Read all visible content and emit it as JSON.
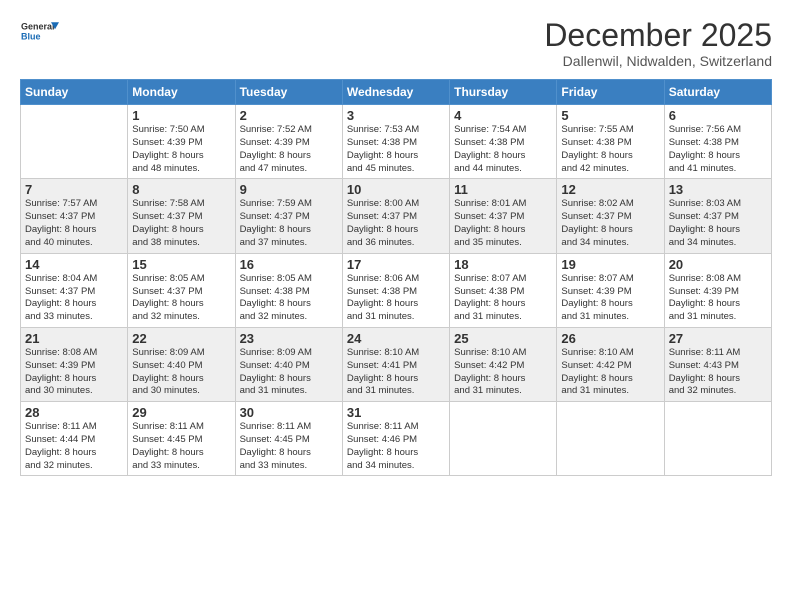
{
  "header": {
    "logo_general": "General",
    "logo_blue": "Blue",
    "month_title": "December 2025",
    "subtitle": "Dallenwil, Nidwalden, Switzerland"
  },
  "days_of_week": [
    "Sunday",
    "Monday",
    "Tuesday",
    "Wednesday",
    "Thursday",
    "Friday",
    "Saturday"
  ],
  "weeks": [
    [
      {
        "num": "",
        "info": ""
      },
      {
        "num": "1",
        "info": "Sunrise: 7:50 AM\nSunset: 4:39 PM\nDaylight: 8 hours\nand 48 minutes."
      },
      {
        "num": "2",
        "info": "Sunrise: 7:52 AM\nSunset: 4:39 PM\nDaylight: 8 hours\nand 47 minutes."
      },
      {
        "num": "3",
        "info": "Sunrise: 7:53 AM\nSunset: 4:38 PM\nDaylight: 8 hours\nand 45 minutes."
      },
      {
        "num": "4",
        "info": "Sunrise: 7:54 AM\nSunset: 4:38 PM\nDaylight: 8 hours\nand 44 minutes."
      },
      {
        "num": "5",
        "info": "Sunrise: 7:55 AM\nSunset: 4:38 PM\nDaylight: 8 hours\nand 42 minutes."
      },
      {
        "num": "6",
        "info": "Sunrise: 7:56 AM\nSunset: 4:38 PM\nDaylight: 8 hours\nand 41 minutes."
      }
    ],
    [
      {
        "num": "7",
        "info": "Sunrise: 7:57 AM\nSunset: 4:37 PM\nDaylight: 8 hours\nand 40 minutes."
      },
      {
        "num": "8",
        "info": "Sunrise: 7:58 AM\nSunset: 4:37 PM\nDaylight: 8 hours\nand 38 minutes."
      },
      {
        "num": "9",
        "info": "Sunrise: 7:59 AM\nSunset: 4:37 PM\nDaylight: 8 hours\nand 37 minutes."
      },
      {
        "num": "10",
        "info": "Sunrise: 8:00 AM\nSunset: 4:37 PM\nDaylight: 8 hours\nand 36 minutes."
      },
      {
        "num": "11",
        "info": "Sunrise: 8:01 AM\nSunset: 4:37 PM\nDaylight: 8 hours\nand 35 minutes."
      },
      {
        "num": "12",
        "info": "Sunrise: 8:02 AM\nSunset: 4:37 PM\nDaylight: 8 hours\nand 34 minutes."
      },
      {
        "num": "13",
        "info": "Sunrise: 8:03 AM\nSunset: 4:37 PM\nDaylight: 8 hours\nand 34 minutes."
      }
    ],
    [
      {
        "num": "14",
        "info": "Sunrise: 8:04 AM\nSunset: 4:37 PM\nDaylight: 8 hours\nand 33 minutes."
      },
      {
        "num": "15",
        "info": "Sunrise: 8:05 AM\nSunset: 4:37 PM\nDaylight: 8 hours\nand 32 minutes."
      },
      {
        "num": "16",
        "info": "Sunrise: 8:05 AM\nSunset: 4:38 PM\nDaylight: 8 hours\nand 32 minutes."
      },
      {
        "num": "17",
        "info": "Sunrise: 8:06 AM\nSunset: 4:38 PM\nDaylight: 8 hours\nand 31 minutes."
      },
      {
        "num": "18",
        "info": "Sunrise: 8:07 AM\nSunset: 4:38 PM\nDaylight: 8 hours\nand 31 minutes."
      },
      {
        "num": "19",
        "info": "Sunrise: 8:07 AM\nSunset: 4:39 PM\nDaylight: 8 hours\nand 31 minutes."
      },
      {
        "num": "20",
        "info": "Sunrise: 8:08 AM\nSunset: 4:39 PM\nDaylight: 8 hours\nand 31 minutes."
      }
    ],
    [
      {
        "num": "21",
        "info": "Sunrise: 8:08 AM\nSunset: 4:39 PM\nDaylight: 8 hours\nand 30 minutes."
      },
      {
        "num": "22",
        "info": "Sunrise: 8:09 AM\nSunset: 4:40 PM\nDaylight: 8 hours\nand 30 minutes."
      },
      {
        "num": "23",
        "info": "Sunrise: 8:09 AM\nSunset: 4:40 PM\nDaylight: 8 hours\nand 31 minutes."
      },
      {
        "num": "24",
        "info": "Sunrise: 8:10 AM\nSunset: 4:41 PM\nDaylight: 8 hours\nand 31 minutes."
      },
      {
        "num": "25",
        "info": "Sunrise: 8:10 AM\nSunset: 4:42 PM\nDaylight: 8 hours\nand 31 minutes."
      },
      {
        "num": "26",
        "info": "Sunrise: 8:10 AM\nSunset: 4:42 PM\nDaylight: 8 hours\nand 31 minutes."
      },
      {
        "num": "27",
        "info": "Sunrise: 8:11 AM\nSunset: 4:43 PM\nDaylight: 8 hours\nand 32 minutes."
      }
    ],
    [
      {
        "num": "28",
        "info": "Sunrise: 8:11 AM\nSunset: 4:44 PM\nDaylight: 8 hours\nand 32 minutes."
      },
      {
        "num": "29",
        "info": "Sunrise: 8:11 AM\nSunset: 4:45 PM\nDaylight: 8 hours\nand 33 minutes."
      },
      {
        "num": "30",
        "info": "Sunrise: 8:11 AM\nSunset: 4:45 PM\nDaylight: 8 hours\nand 33 minutes."
      },
      {
        "num": "31",
        "info": "Sunrise: 8:11 AM\nSunset: 4:46 PM\nDaylight: 8 hours\nand 34 minutes."
      },
      {
        "num": "",
        "info": ""
      },
      {
        "num": "",
        "info": ""
      },
      {
        "num": "",
        "info": ""
      }
    ]
  ]
}
